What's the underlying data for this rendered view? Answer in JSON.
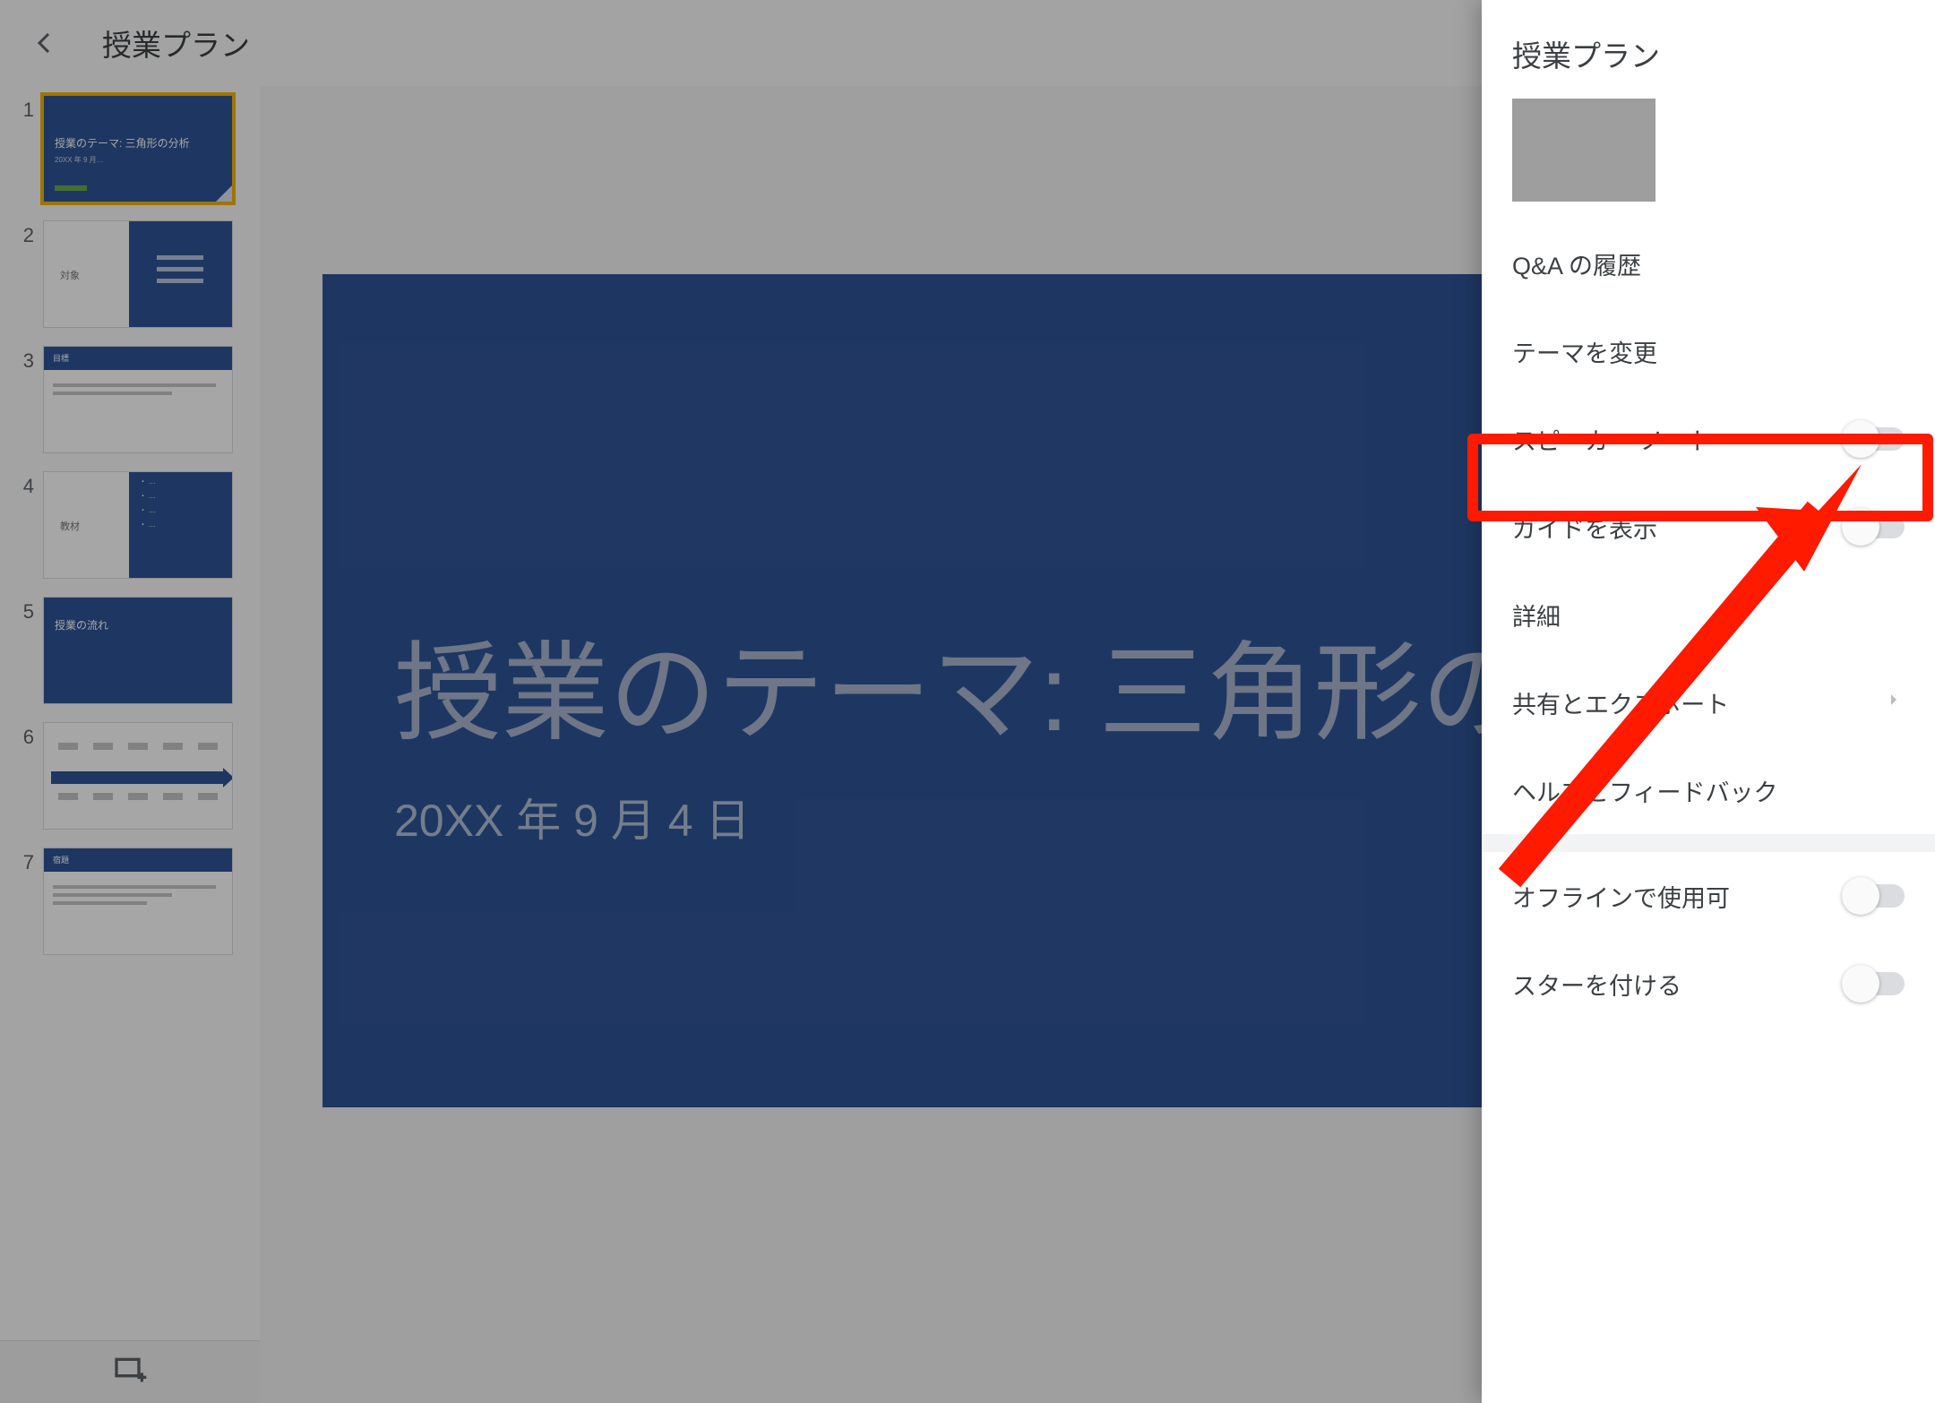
{
  "toolbar": {
    "doc_title": "授業プラン"
  },
  "main_slide": {
    "title": "授業のテーマ: 三角形の",
    "date": "20XX 年 9 月 4 日"
  },
  "thumbnails": [
    {
      "num": "1",
      "kind": "title",
      "title": "授業のテーマ: 三角形の分析",
      "sub": "20XX 年 9 月…"
    },
    {
      "num": "2",
      "kind": "split",
      "left_label": "対象"
    },
    {
      "num": "3",
      "kind": "strip",
      "strip_label": "目標"
    },
    {
      "num": "4",
      "kind": "twocol",
      "left_label": "教材"
    },
    {
      "num": "5",
      "kind": "bluefull",
      "title": "授業の流れ"
    },
    {
      "num": "6",
      "kind": "arrow"
    },
    {
      "num": "7",
      "kind": "strip",
      "strip_label": "宿題"
    }
  ],
  "drawer": {
    "title": "授業プラン",
    "items": {
      "qa_history": "Q&A の履歴",
      "change_theme": "テーマを変更",
      "speaker_notes": "スピーカー ノート",
      "show_guides": "ガイドを表示",
      "details": "詳細",
      "share_export": "共有とエクスポート",
      "help_feedback": "ヘルプとフィードバック",
      "offline": "オフラインで使用可",
      "star": "スターを付ける"
    },
    "toggles": {
      "speaker_notes": false,
      "show_guides": false,
      "offline": false,
      "star": false
    }
  }
}
